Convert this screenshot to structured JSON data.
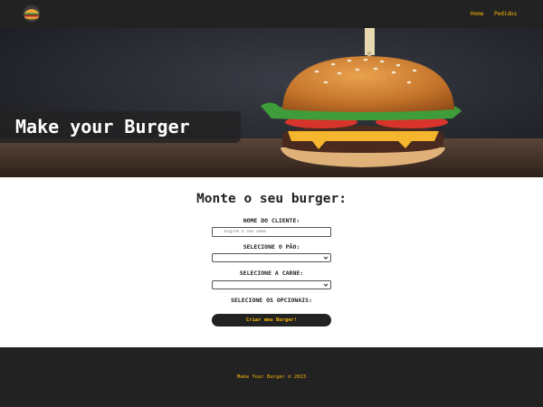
{
  "navbar": {
    "logo": {
      "icon": "burger-logo-icon"
    },
    "links": [
      {
        "label": "Home"
      },
      {
        "label": "Pedidos"
      }
    ]
  },
  "banner": {
    "title": "Make your Burger",
    "image": "burger-photo"
  },
  "form": {
    "title": "Monte o seu burger:",
    "name_label": "Nome do cliente:",
    "name_placeholder": "Digite o seu nome",
    "name_value": "",
    "bread_label": "Selecione o pão:",
    "bread_value": "",
    "meat_label": "Selecione a carne:",
    "meat_value": "",
    "options_label": "Selecione os opcionais:",
    "submit_label": "Criar meu Burger!"
  },
  "footer": {
    "text": "Make Your Burger © 2023"
  },
  "colors": {
    "dark": "#222222",
    "accent": "#fcba03",
    "background": "#ffffff"
  }
}
